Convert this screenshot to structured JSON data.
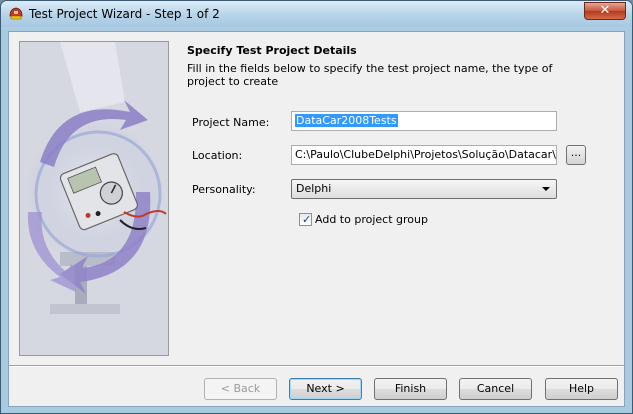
{
  "window": {
    "title": "Test Project Wizard - Step 1 of 2",
    "close_glyph": "✕"
  },
  "header": {
    "heading": "Specify Test Project Details",
    "description": "Fill in the fields below to specify the test project name, the type of project to create"
  },
  "form": {
    "project_name_label": "Project Name:",
    "project_name_value": "DataCar2008Tests",
    "location_label": "Location:",
    "location_value": "C:\\Paulo\\ClubeDelphi\\Projetos\\Solução\\Datacar\\Test",
    "browse_label": "...",
    "personality_label": "Personality:",
    "personality_value": "Delphi",
    "add_to_group_label": "Add to project group",
    "add_to_group_checked": true
  },
  "buttons": {
    "back": "< Back",
    "next": "Next >",
    "finish": "Finish",
    "cancel": "Cancel",
    "help": "Help"
  },
  "colors": {
    "accent": "#3399ff",
    "titlebar": "#b6d3e8"
  },
  "icons": {
    "app": "wizard-helmet-icon",
    "close": "close-icon",
    "combo": "chevron-down-icon",
    "check": "checkmark-icon",
    "illustration": "multimeter-cycle-illustration"
  }
}
